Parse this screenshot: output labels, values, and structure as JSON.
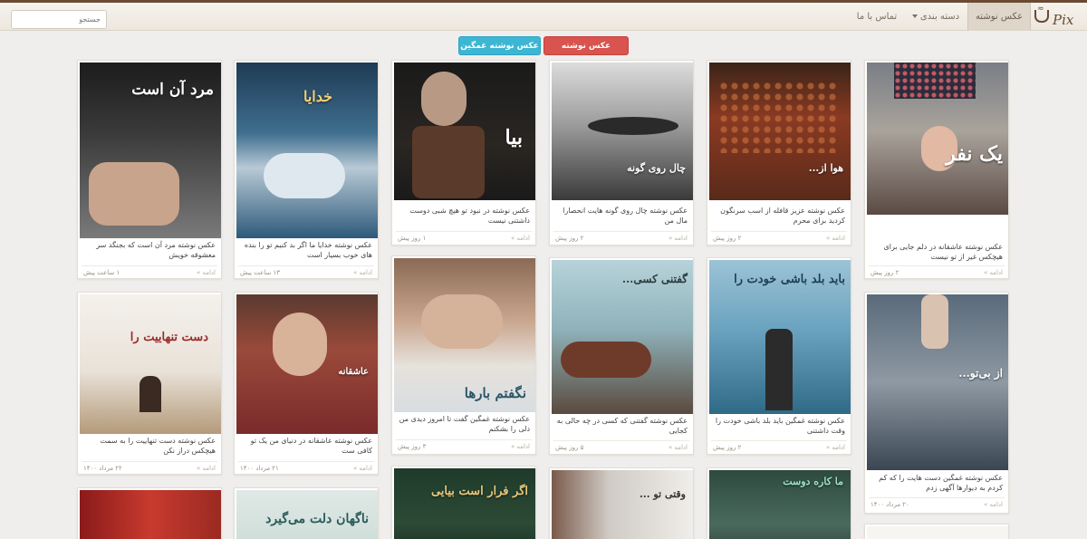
{
  "nav": {
    "logo_text": "Pix",
    "items": [
      {
        "label": "عکس نوشته"
      },
      {
        "label": "دسته بندی"
      },
      {
        "label": "تماس با ما"
      }
    ]
  },
  "search": {
    "placeholder": "جستجو"
  },
  "buttons": {
    "romantic": "عکس نوشته عاشقانه",
    "sad": "عکس نوشته غمگین"
  },
  "cards": [
    {
      "overlay": "یک نفر",
      "caption": "عکس نوشته عاشقانه در دلم جایی برای هیچکس غیر از تو نیست",
      "time": "۲ روز پیش",
      "more": "ادامه »"
    },
    {
      "overlay": "هوا از...",
      "caption": "عکس نوشته عزیز قافله از اسب سرنگون کردید برای محرم",
      "time": "۲ روز پیش",
      "more": "ادامه »"
    },
    {
      "overlay": "چال روی گونه",
      "caption": "عکس نوشته چال روی گونه هایت انحصارا مال من",
      "time": "۲ روز پیش",
      "more": "ادامه »"
    },
    {
      "overlay": "بیا",
      "caption": "عکس نوشته در نبود تو هیچ شبی دوست داشتنی نیست",
      "time": "۱ روز پیش",
      "more": "ادامه »"
    },
    {
      "overlay": "خدایا",
      "caption": "عکس نوشته خدایا ما اگر بد کنیم تو را بنده های خوب بسیار است",
      "time": "۱۳ ساعت پیش",
      "more": "ادامه »"
    },
    {
      "overlay": "مرد آن است",
      "caption": "عکس نوشته مرد آن است که بجنگد سر معشوقه خویش",
      "time": "۱ ساعت پیش",
      "more": "ادامه »"
    },
    {
      "overlay": "از بی‌تو...",
      "caption": "عکس نوشته غمگین دست هایت را که کم کردم به دیوارها آگهی زدم",
      "time": "۲۰ مرداد ۱۴۰۰",
      "more": "ادامه »"
    },
    {
      "overlay": "باید بلد باشی خودت را",
      "caption": "عکس نوشته غمگین باید بلد باشی خودت را وقت داشتنی",
      "time": "۲ روز پیش",
      "more": "ادامه »"
    },
    {
      "overlay": "گفتنی کسی...",
      "caption": "عکس نوشته گفتنی که کسی در چه حالی به کجایی",
      "time": "۵ روز پیش",
      "more": "ادامه »"
    },
    {
      "overlay": "نگفتم بارها",
      "caption": "عکس نوشته غمگین گفت تا امروز دیدی من دلی را بشکنم",
      "time": "۳ روز پیش",
      "more": "ادامه »"
    },
    {
      "overlay": "عاشقانه",
      "caption": "عکس نوشته عاشقانه در دنیای من یک تو کافی ست",
      "time": "۲۱ مرداد ۱۴۰۰",
      "more": "ادامه »"
    },
    {
      "overlay": "دست تنهاییت را",
      "caption": "عکس نوشته دست تنهاییت را به سمت هیچکس دراز نکن",
      "time": "۲۲ مرداد ۱۴۰۰",
      "more": "ادامه »"
    },
    {
      "overlay": "",
      "caption": "",
      "time": "",
      "more": ""
    },
    {
      "overlay": "ما کاره دوست",
      "caption": "",
      "time": "",
      "more": ""
    },
    {
      "overlay": "وقتی تو ...",
      "caption": "",
      "time": "",
      "more": ""
    },
    {
      "overlay": "اگر فرار است بیایی",
      "caption": "",
      "time": "",
      "more": ""
    },
    {
      "overlay": "ناگهان دلت می‌گیرد",
      "caption": "",
      "time": "",
      "more": ""
    },
    {
      "overlay": "",
      "caption": "",
      "time": "",
      "more": ""
    }
  ]
}
